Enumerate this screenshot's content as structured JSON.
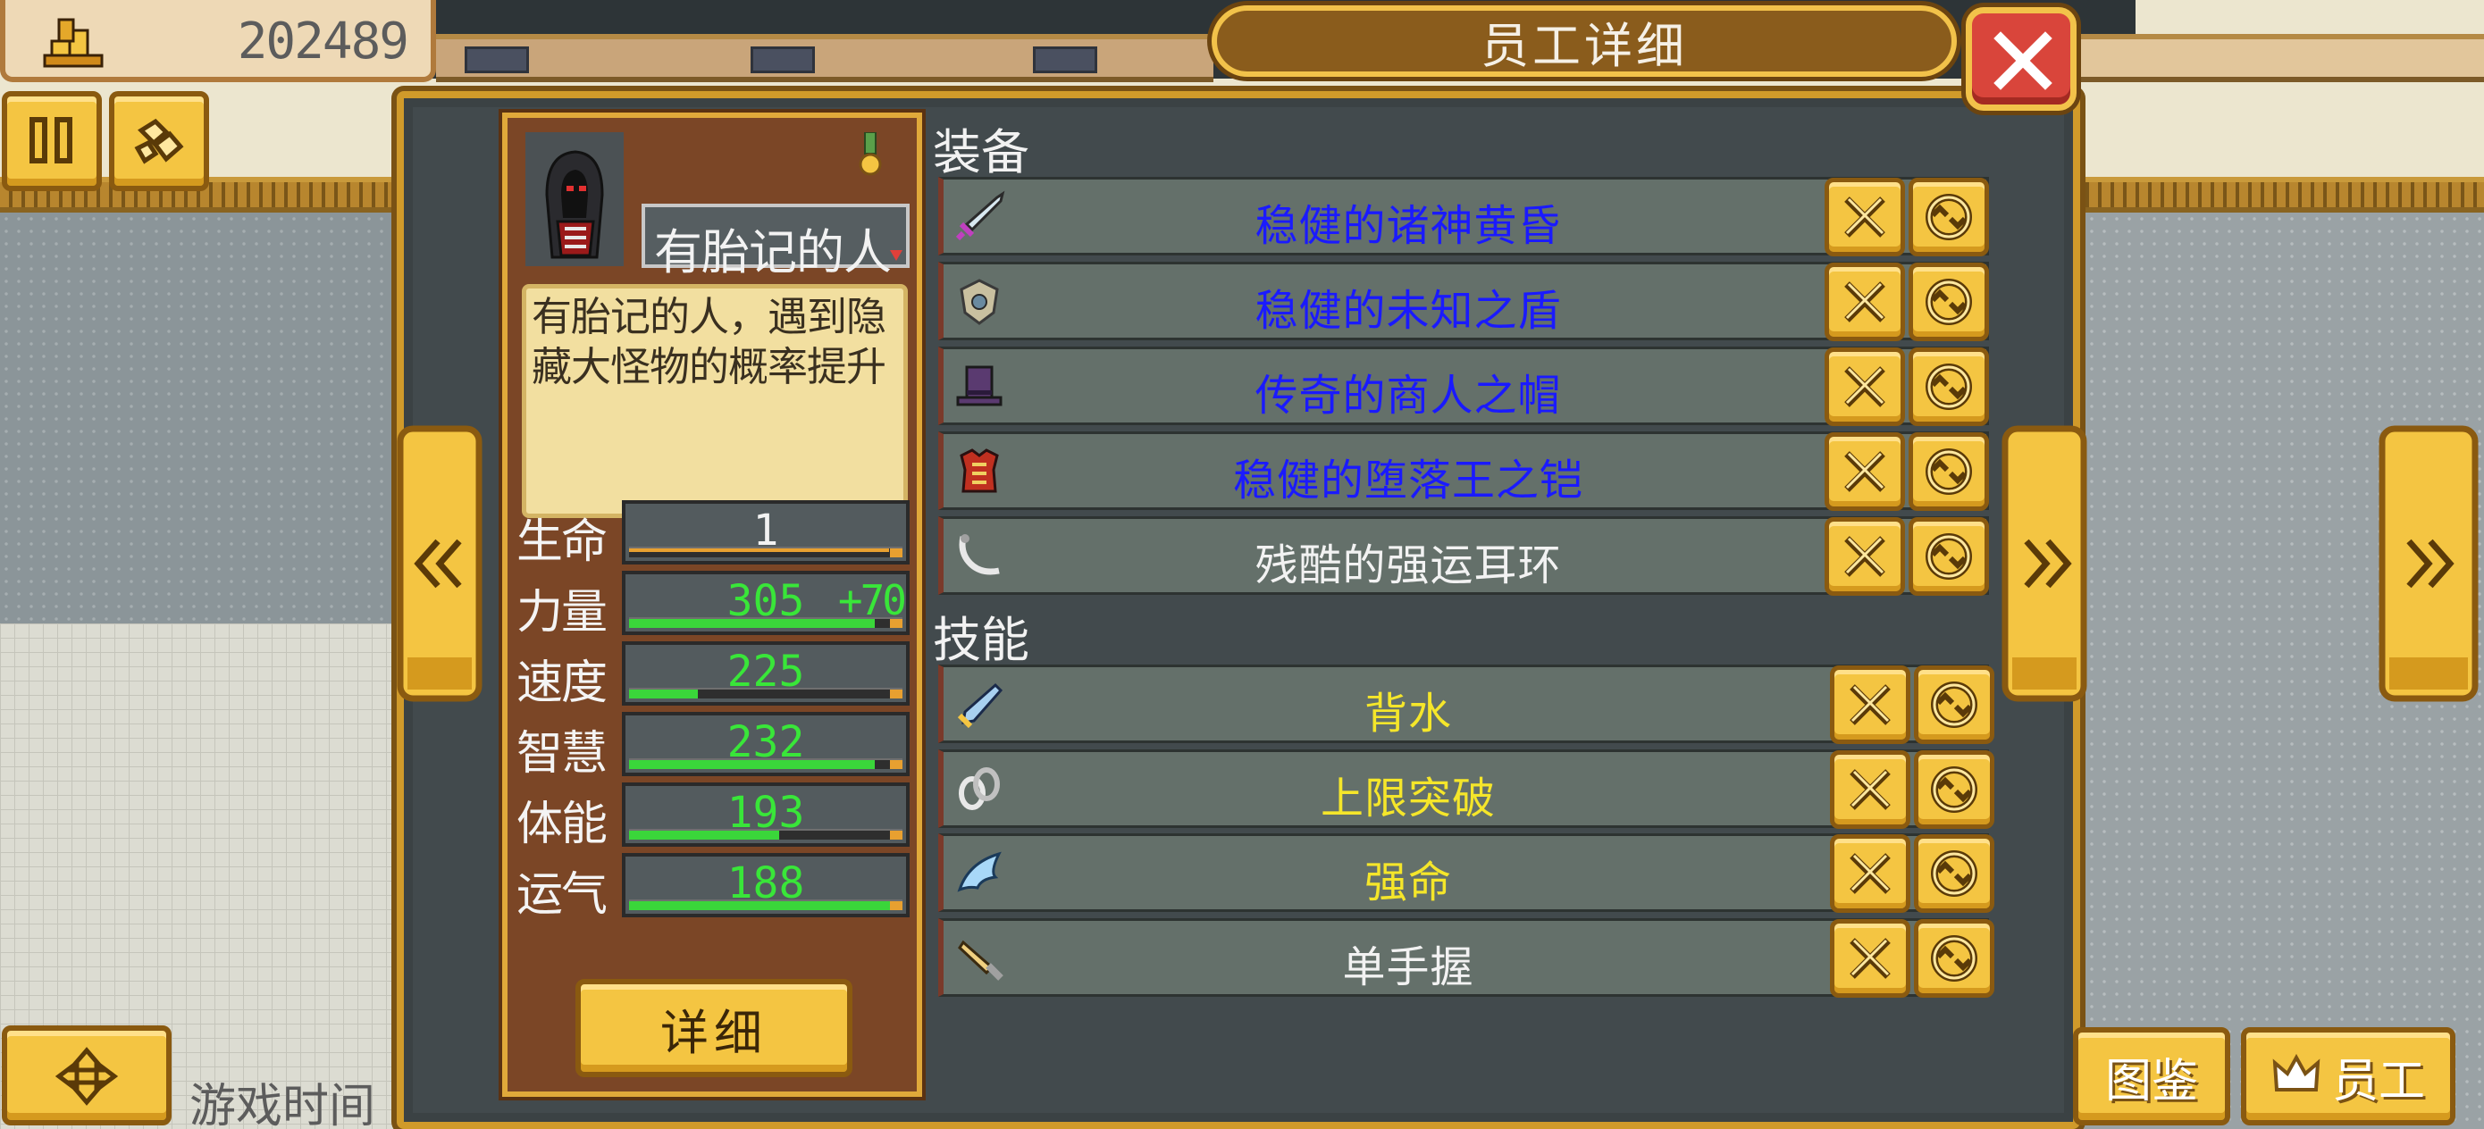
{
  "top_bar": {
    "money_icon": "gold-bars-icon",
    "money_value": "202489"
  },
  "left_buttons": {
    "pause_icon": "pause-icon",
    "items_icon": "stones-icon"
  },
  "dialog": {
    "title": "员工详细",
    "close_icon": "close-icon"
  },
  "character": {
    "name": "有胎记的人",
    "description": "有胎记的人，遇到隐藏大怪物的概率提升",
    "portrait_icon": "hooded-figure-icon",
    "medal_icon": "medal-icon",
    "stats": [
      {
        "label": "生命",
        "value": "1",
        "bonus": "",
        "fill": 0.0,
        "color": "#f2f2f2"
      },
      {
        "label": "力量",
        "value": "305",
        "bonus": "+70",
        "fill": 0.9,
        "color": "#39e639"
      },
      {
        "label": "速度",
        "value": "225",
        "bonus": "",
        "fill": 0.25,
        "color": "#39e639"
      },
      {
        "label": "智慧",
        "value": "232",
        "bonus": "",
        "fill": 0.9,
        "color": "#39e639"
      },
      {
        "label": "体能",
        "value": "193",
        "bonus": "",
        "fill": 0.55,
        "color": "#39e639"
      },
      {
        "label": "运气",
        "value": "188",
        "bonus": "",
        "fill": 0.98,
        "color": "#39e639"
      }
    ],
    "detail_button": "详细"
  },
  "equipment": {
    "heading": "装备",
    "items": [
      {
        "name": "稳健的诸神黄昏",
        "icon": "sword-icon",
        "color": "#1a1aff"
      },
      {
        "name": "稳健的未知之盾",
        "icon": "shield-icon",
        "color": "#1a1aff"
      },
      {
        "name": "传奇的商人之帽",
        "icon": "top-hat-icon",
        "color": "#1a1aff"
      },
      {
        "name": "稳健的堕落王之铠",
        "icon": "armor-icon",
        "color": "#1a1aff"
      },
      {
        "name": "残酷的强运耳环",
        "icon": "earring-icon",
        "color": "#f2f2f2"
      }
    ]
  },
  "skills": {
    "heading": "技能",
    "items": [
      {
        "name": "背水",
        "icon": "blade-skill-icon",
        "color": "#f5e62a"
      },
      {
        "name": "上限突破",
        "icon": "chain-skill-icon",
        "color": "#f5e62a"
      },
      {
        "name": "强命",
        "icon": "wing-skill-icon",
        "color": "#f5e62a"
      },
      {
        "name": "单手握",
        "icon": "hand-skill-icon",
        "color": "#f2f2f2"
      }
    ]
  },
  "row_actions": {
    "remove_icon": "remove-x-icon",
    "swap_icon": "swap-icon"
  },
  "navigation": {
    "prev_icon": "double-chevron-left-icon",
    "next_icon": "double-chevron-right-icon"
  },
  "bottom": {
    "move_icon": "dpad-icon",
    "game_time_label": "游戏时间",
    "codex_label": "图鉴",
    "staff_label": "员工",
    "staff_icon": "crown-icon"
  },
  "colors": {
    "panel": "#424a4d",
    "gold": "#f4c542",
    "card": "#7b4626",
    "close": "#d9453b"
  }
}
